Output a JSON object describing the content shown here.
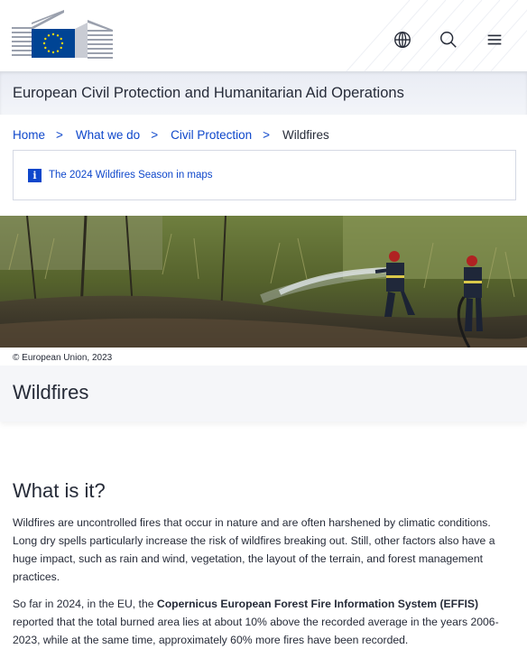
{
  "header": {
    "icons": [
      "globe-icon",
      "search-icon",
      "menu-icon"
    ],
    "flag_color": "#004494",
    "star_color": "#ffde00"
  },
  "site": {
    "name": "European Civil Protection and Humanitarian Aid Operations"
  },
  "breadcrumb": {
    "items": [
      {
        "label": "Home"
      },
      {
        "label": "What we do"
      },
      {
        "label": "Civil Protection"
      }
    ],
    "current": "Wildfires",
    "separator": ">"
  },
  "info": {
    "icon": "i",
    "link_label": "The 2024 Wildfires Season in maps"
  },
  "hero": {
    "copyright": "© European Union, 2023"
  },
  "page": {
    "title": "Wildfires"
  },
  "section": {
    "title": "What is it?",
    "para1": "Wildfires are uncontrolled fires that occur in nature and are often harshened by climatic conditions. Long dry spells particularly increase the risk of wildfires breaking out. Still, other factors also have a huge impact, such as rain and wind, vegetation, the layout of the terrain, and forest management practices.",
    "para2_before": "So far in 2024, in the EU, the ",
    "para2_bold": "Copernicus European Forest Fire Information System (EFFIS)",
    "para2_after": " reported that the total burned area lies at about 10% above the recorded average in the years 2006-2023, while at the same time, approximately 60% more fires have been recorded."
  },
  "colors": {
    "link": "#0e47cb",
    "text": "#262b38"
  }
}
